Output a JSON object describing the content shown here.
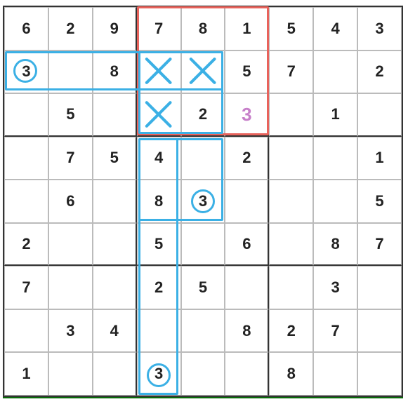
{
  "grid": [
    [
      "6",
      "2",
      "9",
      "7",
      "8",
      "1",
      "5",
      "4",
      "3"
    ],
    [
      "3",
      "",
      "8",
      "",
      "",
      "5",
      "7",
      "",
      "2"
    ],
    [
      "",
      "5",
      "",
      "",
      "2",
      "",
      "",
      "1",
      ""
    ],
    [
      "",
      "7",
      "5",
      "4",
      "",
      "2",
      "",
      "",
      "1"
    ],
    [
      "",
      "6",
      "",
      "8",
      "3",
      "",
      "",
      "",
      "5"
    ],
    [
      "2",
      "",
      "",
      "5",
      "",
      "6",
      "",
      "8",
      "7"
    ],
    [
      "7",
      "",
      "",
      "2",
      "5",
      "",
      "",
      "3",
      ""
    ],
    [
      "",
      "3",
      "4",
      "",
      "",
      "8",
      "2",
      "7",
      ""
    ],
    [
      "1",
      "",
      "",
      "3",
      "",
      "",
      "8",
      "",
      ""
    ]
  ],
  "hint": {
    "row": 2,
    "col": 5,
    "value": "3"
  },
  "highlights": {
    "red_box": {
      "r0": 0,
      "c0": 3,
      "r1": 2,
      "c1": 5
    },
    "blue_boxes": [
      {
        "r0": 1,
        "c0": 0,
        "r1": 1,
        "c1": 4
      },
      {
        "r0": 1,
        "c0": 3,
        "r1": 2,
        "c1": 4
      },
      {
        "r0": 3,
        "c0": 3,
        "r1": 4,
        "c1": 4
      },
      {
        "r0": 3,
        "c0": 3,
        "r1": 8,
        "c1": 3
      }
    ],
    "x_marks": [
      {
        "r": 1,
        "c": 3
      },
      {
        "r": 1,
        "c": 4
      },
      {
        "r": 2,
        "c": 3
      }
    ],
    "circles": [
      {
        "r": 1,
        "c": 0
      },
      {
        "r": 4,
        "c": 4
      },
      {
        "r": 8,
        "c": 3
      }
    ]
  }
}
